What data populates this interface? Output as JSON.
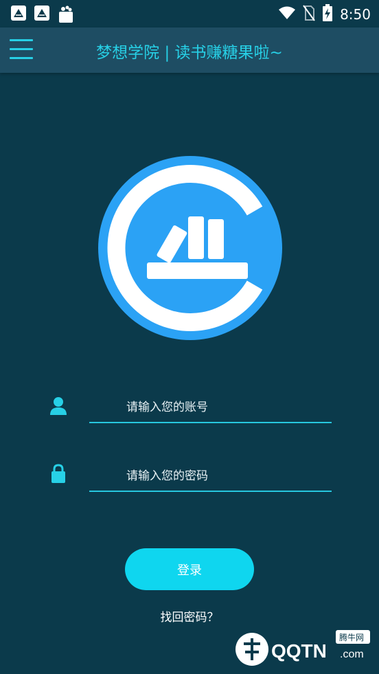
{
  "status_bar": {
    "time": "8:50",
    "icons": [
      "app-notification-icon",
      "app-notification-icon",
      "shopping-bag-icon",
      "wifi-icon",
      "no-sim-icon",
      "battery-charging-icon"
    ]
  },
  "app_bar": {
    "title": "梦想学院 | 读书赚糖果啦~",
    "menu_icon": "hamburger-menu-icon"
  },
  "logo": {
    "icon": "books-logo-icon",
    "brand_color": "#2ba2f5"
  },
  "form": {
    "account": {
      "placeholder": "请输入您的账号",
      "value": "",
      "icon": "user-icon"
    },
    "password": {
      "placeholder": "请输入您的密码",
      "value": "",
      "icon": "lock-icon"
    },
    "login_label": "登录",
    "forgot_label": "找回密码？"
  },
  "watermark": {
    "brand_text": "QQTN",
    "suffix": ".com",
    "tag": "腾牛网"
  },
  "colors": {
    "background": "#0b3a4b",
    "app_bar": "#1e4d63",
    "accent": "#27d0e6",
    "button": "#0fd6ef"
  }
}
